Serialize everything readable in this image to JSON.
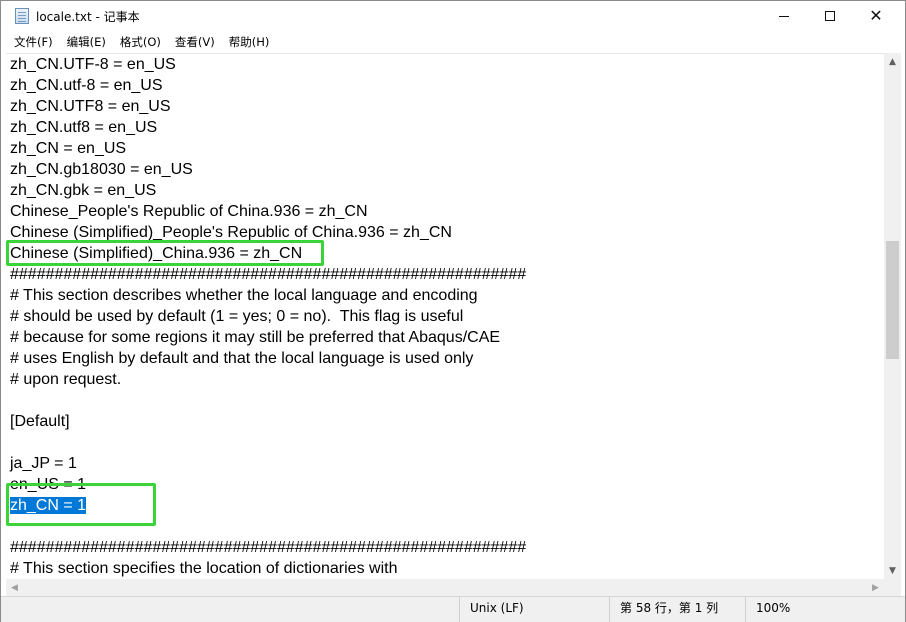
{
  "window": {
    "title": "locale.txt - 记事本",
    "close_glyph": "✕"
  },
  "menu": [
    "文件(F)",
    "编辑(E)",
    "格式(O)",
    "查看(V)",
    "帮助(H)"
  ],
  "editor": {
    "lines": [
      "zh_CN.UTF-8 = en_US",
      "zh_CN.utf-8 = en_US",
      "zh_CN.UTF8 = en_US",
      "zh_CN.utf8 = en_US",
      "zh_CN = en_US",
      "zh_CN.gb18030 = en_US",
      "zh_CN.gbk = en_US",
      "Chinese_People's Republic of China.936 = zh_CN",
      "Chinese (Simplified)_People's Republic of China.936 = zh_CN",
      "Chinese (Simplified)_China.936 = zh_CN",
      "##########################################################",
      "# This section describes whether the local language and encoding",
      "# should be used by default (1 = yes; 0 = no).  This flag is useful",
      "# because for some regions it may still be preferred that Abaqus/CAE",
      "# uses English by default and that the local language is used only",
      "# upon request.",
      "",
      "[Default]",
      "",
      "ja_JP = 1",
      "en_US = 1",
      "zh_CN = 1",
      "",
      "##########################################################",
      "# This section specifies the location of dictionaries with"
    ],
    "selected_line_index": 21
  },
  "scrollbar": {
    "up_arrow": "▲",
    "down_arrow": "▼",
    "left_arrow": "◀",
    "right_arrow": "▶"
  },
  "status": {
    "line_ending": "Unix (LF)",
    "position": "第 58 行，第 1 列",
    "zoom": "100%"
  },
  "colors": {
    "highlight_box": "#3ad43a",
    "selection": "#0078d7"
  }
}
